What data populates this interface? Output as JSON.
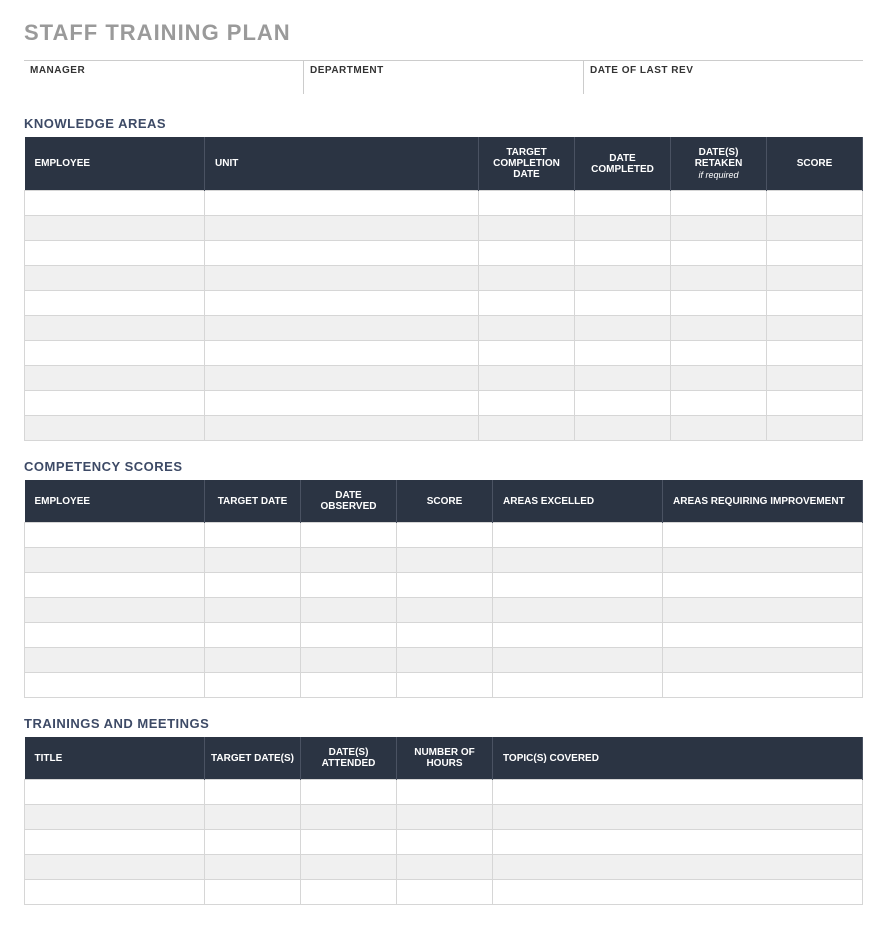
{
  "title": "STAFF TRAINING PLAN",
  "meta": {
    "manager_label": "MANAGER",
    "department_label": "DEPARTMENT",
    "date_rev_label": "DATE OF LAST REV",
    "manager_value": "",
    "department_value": "",
    "date_rev_value": ""
  },
  "sections": {
    "knowledge": {
      "heading": "KNOWLEDGE AREAS",
      "headers": {
        "employee": "EMPLOYEE",
        "unit": "UNIT",
        "target": "TARGET COMPLETION DATE",
        "date_completed": "DATE COMPLETED",
        "retaken": "DATE(S) RETAKEN",
        "retaken_sub": "if required",
        "score": "SCORE"
      },
      "rows": [
        {
          "employee": "",
          "unit": "",
          "target": "",
          "date_completed": "",
          "retaken": "",
          "score": ""
        },
        {
          "employee": "",
          "unit": "",
          "target": "",
          "date_completed": "",
          "retaken": "",
          "score": ""
        },
        {
          "employee": "",
          "unit": "",
          "target": "",
          "date_completed": "",
          "retaken": "",
          "score": ""
        },
        {
          "employee": "",
          "unit": "",
          "target": "",
          "date_completed": "",
          "retaken": "",
          "score": ""
        },
        {
          "employee": "",
          "unit": "",
          "target": "",
          "date_completed": "",
          "retaken": "",
          "score": ""
        },
        {
          "employee": "",
          "unit": "",
          "target": "",
          "date_completed": "",
          "retaken": "",
          "score": ""
        },
        {
          "employee": "",
          "unit": "",
          "target": "",
          "date_completed": "",
          "retaken": "",
          "score": ""
        },
        {
          "employee": "",
          "unit": "",
          "target": "",
          "date_completed": "",
          "retaken": "",
          "score": ""
        },
        {
          "employee": "",
          "unit": "",
          "target": "",
          "date_completed": "",
          "retaken": "",
          "score": ""
        },
        {
          "employee": "",
          "unit": "",
          "target": "",
          "date_completed": "",
          "retaken": "",
          "score": ""
        }
      ]
    },
    "competency": {
      "heading": "COMPETENCY SCORES",
      "headers": {
        "employee": "EMPLOYEE",
        "target_date": "TARGET DATE",
        "date_observed": "DATE OBSERVED",
        "score": "SCORE",
        "excelled": "AREAS EXCELLED",
        "improvement": "AREAS REQUIRING IMPROVEMENT"
      },
      "rows": [
        {
          "employee": "",
          "target_date": "",
          "date_observed": "",
          "score": "",
          "excelled": "",
          "improvement": ""
        },
        {
          "employee": "",
          "target_date": "",
          "date_observed": "",
          "score": "",
          "excelled": "",
          "improvement": ""
        },
        {
          "employee": "",
          "target_date": "",
          "date_observed": "",
          "score": "",
          "excelled": "",
          "improvement": ""
        },
        {
          "employee": "",
          "target_date": "",
          "date_observed": "",
          "score": "",
          "excelled": "",
          "improvement": ""
        },
        {
          "employee": "",
          "target_date": "",
          "date_observed": "",
          "score": "",
          "excelled": "",
          "improvement": ""
        },
        {
          "employee": "",
          "target_date": "",
          "date_observed": "",
          "score": "",
          "excelled": "",
          "improvement": ""
        },
        {
          "employee": "",
          "target_date": "",
          "date_observed": "",
          "score": "",
          "excelled": "",
          "improvement": ""
        }
      ]
    },
    "trainings": {
      "heading": "TRAININGS AND MEETINGS",
      "headers": {
        "title": "TITLE",
        "target_dates": "TARGET DATE(S)",
        "attended": "DATE(S) ATTENDED",
        "hours": "NUMBER OF HOURS",
        "topics": "TOPIC(S) COVERED"
      },
      "rows": [
        {
          "title": "",
          "target_dates": "",
          "attended": "",
          "hours": "",
          "topics": ""
        },
        {
          "title": "",
          "target_dates": "",
          "attended": "",
          "hours": "",
          "topics": ""
        },
        {
          "title": "",
          "target_dates": "",
          "attended": "",
          "hours": "",
          "topics": ""
        },
        {
          "title": "",
          "target_dates": "",
          "attended": "",
          "hours": "",
          "topics": ""
        },
        {
          "title": "",
          "target_dates": "",
          "attended": "",
          "hours": "",
          "topics": ""
        }
      ]
    }
  }
}
